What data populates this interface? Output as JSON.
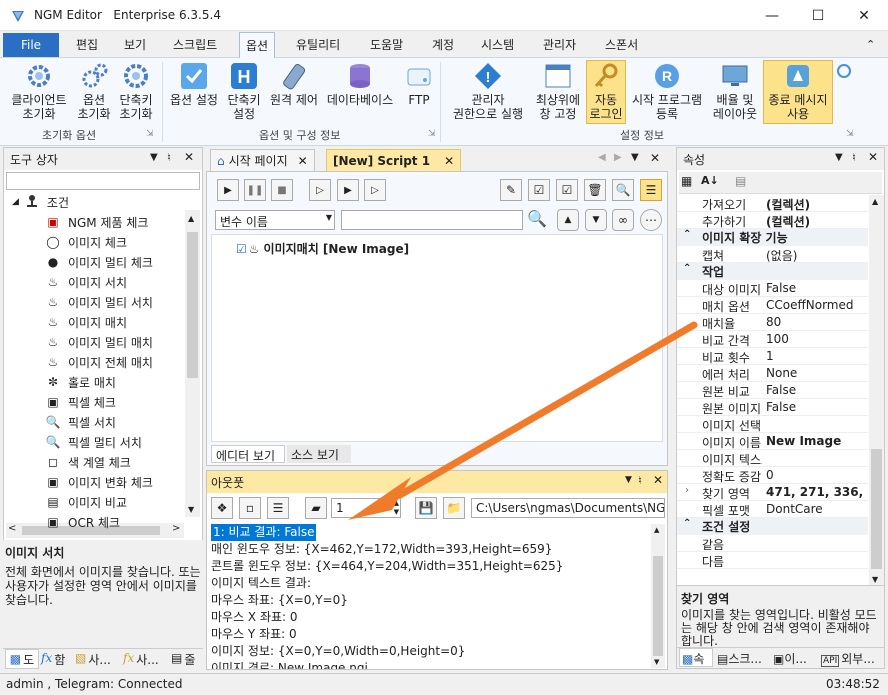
{
  "app": {
    "title": "NGM Editor",
    "edition": "Enterprise 6.3.5.4"
  },
  "menu": {
    "file": "File",
    "tabs": [
      "편집",
      "보기",
      "스크립트",
      "옵션",
      "유틸리티",
      "도움말",
      "계정",
      "시스템",
      "관리자",
      "스폰서"
    ]
  },
  "ribbon": {
    "groups": [
      "초기화 옵션",
      "옵션 및 구성 정보",
      "설정 정보"
    ],
    "buttons": [
      {
        "line1": "클라이언트",
        "line2": "초기화"
      },
      {
        "line1": "옵션",
        "line2": "초기화"
      },
      {
        "line1": "단축키",
        "line2": "초기화"
      },
      {
        "line1": "옵션 설정",
        "line2": ""
      },
      {
        "line1": "단축키",
        "line2": "설정"
      },
      {
        "line1": "원격 제어",
        "line2": ""
      },
      {
        "line1": "데이타베이스",
        "line2": ""
      },
      {
        "line1": "FTP",
        "line2": ""
      },
      {
        "line1": "관리자",
        "line2": "권한으로 실행"
      },
      {
        "line1": "최상위에",
        "line2": "창 고정"
      },
      {
        "line1": "자동",
        "line2": "로그인"
      },
      {
        "line1": "시작 프로그램",
        "line2": "등록"
      },
      {
        "line1": "배율 및",
        "line2": "레이아웃"
      },
      {
        "line1": "종료 메시지",
        "line2": "사용"
      }
    ]
  },
  "toolbox": {
    "title": "도구 상자",
    "root": "조건",
    "items": [
      "NGM 제품 체크",
      "이미지 체크",
      "이미지 멀티 체크",
      "이미지 서치",
      "이미지 멀티 서치",
      "이미지 매치",
      "이미지 멀티 매치",
      "이미지 전체 매치",
      "홀로 매치",
      "픽셀 체크",
      "픽셀 서치",
      "픽셀 멀티 서치",
      "색 계열 체크",
      "이미지 변화 체크",
      "이미지 비교",
      "OCR 체크"
    ],
    "description_title": "이미지 서치",
    "description": "전체 화면에서 이미지를 찾습니다. 또는 사용자가 설정한 영역 안에서 이미지를 찾습니다.",
    "bottom_tabs": [
      "도",
      "함",
      "사...",
      "사...",
      "줄"
    ]
  },
  "document": {
    "tabs": [
      "시작 페이지",
      "[New] Script 1"
    ],
    "filter_select": "변수 이름",
    "script_item": "이미지매치 [New Image]",
    "view_tabs": [
      "에디터 보기",
      "소스 보기"
    ]
  },
  "output": {
    "title": "아웃풋",
    "spin_value": "1",
    "path": "C:\\Users\\ngmas\\Documents\\NGM6\\",
    "lines": [
      "1: 비교 결과: False",
      "매인 윈도우 정보: {X=462,Y=172,Width=393,Height=659}",
      "콘트롤 윈도우 정보: {X=464,Y=204,Width=351,Height=625}",
      "이미지 텍스트 결과:",
      "마우스 좌표: {X=0,Y=0}",
      "마우스 X 좌표: 0",
      "마우스 Y 좌표: 0",
      "이미지 정보: {X=0,Y=0,Width=0,Height=0}",
      "이미지 경로: New Image,ngi"
    ]
  },
  "properties": {
    "title": "속성",
    "rows": [
      {
        "type": "prop",
        "name": "가져오기",
        "value": "(컬렉션)"
      },
      {
        "type": "prop",
        "name": "추가하기",
        "value": "(컬렉션)"
      },
      {
        "type": "cat",
        "name": "이미지 확장 기능"
      },
      {
        "type": "prop",
        "name": "캡쳐",
        "value": "(없음)"
      },
      {
        "type": "cat",
        "name": "작업"
      },
      {
        "type": "prop",
        "name": "대상 이미지",
        "value": "False"
      },
      {
        "type": "prop",
        "name": "매치 옵션",
        "value": "CCoeffNormed"
      },
      {
        "type": "prop",
        "name": "매치율",
        "value": "80"
      },
      {
        "type": "prop",
        "name": "비교 간격",
        "value": "100"
      },
      {
        "type": "prop",
        "name": "비교 횟수",
        "value": "1"
      },
      {
        "type": "prop",
        "name": "에러 처리",
        "value": "None"
      },
      {
        "type": "prop",
        "name": "원본 비교",
        "value": "False"
      },
      {
        "type": "prop",
        "name": "원본 이미지",
        "value": "False"
      },
      {
        "type": "prop",
        "name": "이미지 선택",
        "value": ""
      },
      {
        "type": "prop",
        "name": "이미지 이름",
        "value": "New Image"
      },
      {
        "type": "prop",
        "name": "이미지 텍스트",
        "value": ""
      },
      {
        "type": "prop",
        "name": "정확도 증감",
        "value": "0"
      },
      {
        "type": "prop",
        "name": "찾기 영역",
        "value": "471, 271, 336, 5"
      },
      {
        "type": "prop",
        "name": "픽셀 포맷",
        "value": "DontCare"
      },
      {
        "type": "cat",
        "name": "조건 설정"
      },
      {
        "type": "prop",
        "name": "같음",
        "value": ""
      },
      {
        "type": "prop",
        "name": "다름",
        "value": ""
      }
    ],
    "description_title": "찾기 영역",
    "description": "이미지를 찾는 영역입니다. 비활성 모드는 해당 창 안에 검색 영역이 존재해야 합니다.",
    "bottom_tabs": [
      "속",
      "스크...",
      "이...",
      "외부..."
    ]
  },
  "status": {
    "user_text": "admin , Telegram: Connected",
    "time": "03:48:52"
  },
  "colors": {
    "accent": "#2b6fc5",
    "highlight": "#fde28c",
    "arrow": "#f07b2a",
    "selection": "#0078d7"
  }
}
